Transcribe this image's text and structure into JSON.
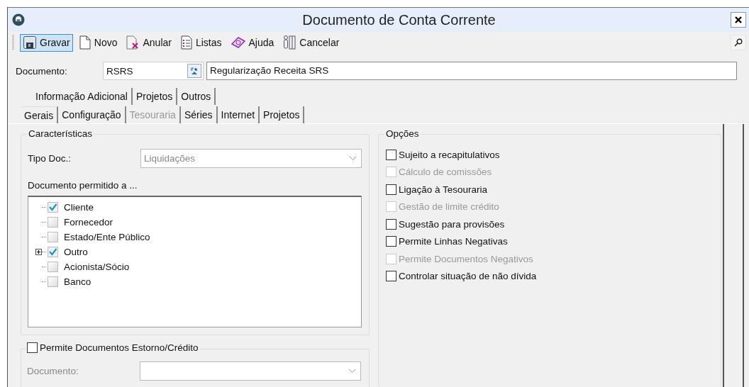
{
  "window": {
    "title": "Documento de Conta Corrente"
  },
  "toolbar": {
    "buttons": [
      {
        "label": "Gravar",
        "kind": "save",
        "selected": true
      },
      {
        "label": "Novo",
        "kind": "new",
        "selected": false
      },
      {
        "label": "Anular",
        "kind": "void",
        "selected": false
      },
      {
        "label": "Listas",
        "kind": "list",
        "selected": false
      },
      {
        "label": "Ajuda",
        "kind": "help",
        "selected": false
      },
      {
        "label": "Cancelar",
        "kind": "cancel",
        "selected": false
      }
    ]
  },
  "document": {
    "label": "Documento:",
    "code": "RSRS",
    "description": "Regularização Receita SRS"
  },
  "tabs_row_1": [
    {
      "label": "Informação Adicional",
      "selected": false
    },
    {
      "label": "Projetos",
      "selected": false
    },
    {
      "label": "Outros",
      "selected": false
    }
  ],
  "tabs": [
    {
      "label": "Gerais",
      "selected": true,
      "disabled": false
    },
    {
      "label": "Configuração",
      "selected": false,
      "disabled": false
    },
    {
      "label": "Tesouraria",
      "selected": false,
      "disabled": true
    },
    {
      "label": "Séries",
      "selected": false,
      "disabled": false
    },
    {
      "label": "Internet",
      "selected": false,
      "disabled": false
    },
    {
      "label": "Projetos",
      "selected": false,
      "disabled": false
    }
  ],
  "caracteristicas": {
    "title": "Características",
    "tipo_doc_label": "Tipo Doc.:",
    "tipo_doc_value": "Liquidações",
    "tipo_doc_disabled": true,
    "permitted_label": "Documento permitido a ...",
    "permitted": [
      {
        "label": "Cliente",
        "checked": true,
        "kind": "leaf"
      },
      {
        "label": "Fornecedor",
        "checked": false,
        "kind": "leaf"
      },
      {
        "label": "Estado/Ente Público",
        "checked": false,
        "kind": "leaf"
      },
      {
        "label": "Outro",
        "checked": true,
        "kind": "branch"
      },
      {
        "label": "Acionista/Sócio",
        "checked": false,
        "kind": "leaf"
      },
      {
        "label": "Banco",
        "checked": false,
        "kind": "leaf"
      }
    ]
  },
  "estorno": {
    "label": "Permite Documentos Estorno/Crédito",
    "checked": false,
    "document_label": "Documento:",
    "disabled": true
  },
  "opcoes": {
    "title": "Opções",
    "items": [
      {
        "label": "Sujeito a recapitulativos",
        "checked": false,
        "disabled": false
      },
      {
        "label": "Cálculo de comissões",
        "checked": false,
        "disabled": true
      },
      {
        "label": "Ligação à Tesouraria",
        "checked": false,
        "disabled": false
      },
      {
        "label": "Gestão de limite crédito",
        "checked": false,
        "disabled": true
      },
      {
        "label": "Sugestão para provisões",
        "checked": false,
        "disabled": false
      },
      {
        "label": "Permite Linhas Negativas",
        "checked": false,
        "disabled": false
      },
      {
        "label": "Permite Documentos Negativos",
        "checked": false,
        "disabled": true
      },
      {
        "label": "Controlar situação de não dívida",
        "checked": false,
        "disabled": false
      }
    ]
  }
}
